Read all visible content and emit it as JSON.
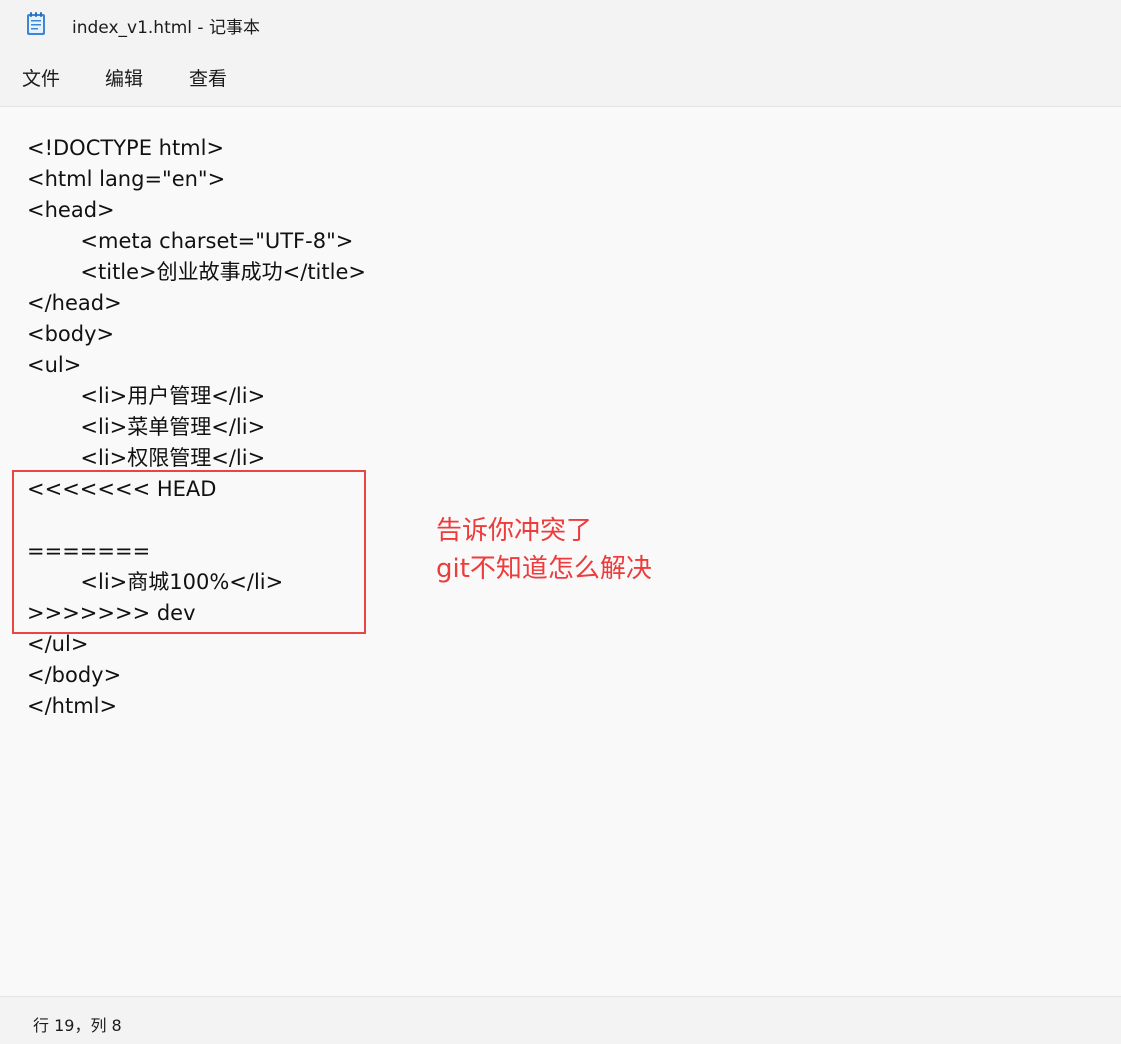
{
  "window": {
    "title": "index_v1.html - 记事本",
    "icon": "notepad-icon"
  },
  "menu": {
    "file": "文件",
    "edit": "编辑",
    "view": "查看"
  },
  "editor": {
    "lines": [
      "<!DOCTYPE html>",
      "<html lang=\"en\">",
      "<head>",
      "        <meta charset=\"UTF-8\">",
      "        <title>创业故事成功</title>",
      "</head>",
      "<body>",
      "<ul>",
      "        <li>用户管理</li>",
      "        <li>菜单管理</li>",
      "        <li>权限管理</li>",
      "<<<<<<< HEAD",
      "",
      "=======",
      "        <li>商城100%</li>",
      ">>>>>>> dev",
      "</ul>",
      "</body>",
      "</html>"
    ]
  },
  "annotation": {
    "line1": "告诉你冲突了",
    "line2": "git不知道怎么解决",
    "color": "#ee3b3b"
  },
  "status": {
    "position": "行 19，列 8"
  }
}
